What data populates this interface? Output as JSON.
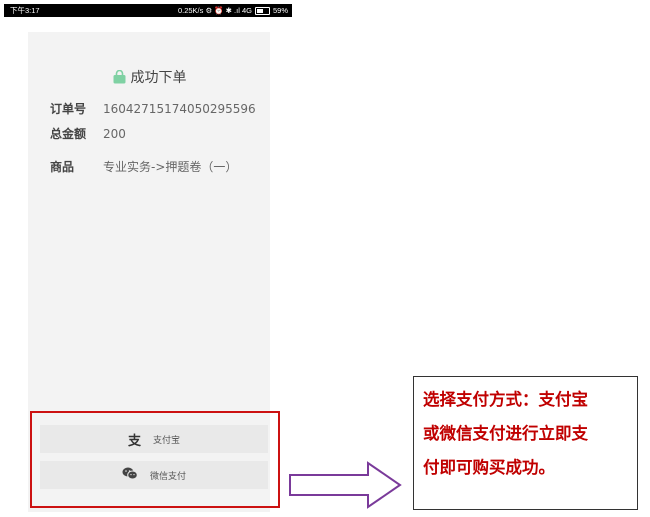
{
  "status_bar": {
    "time": "下午3:17",
    "indicators": "0.25K/s ⚙ ⏰ ✱ .ıl 4G",
    "battery": "59%",
    "battery_level": 0.59
  },
  "order": {
    "title": "成功下单",
    "fields": [
      {
        "label": "订单号",
        "value": "16042715174050295596"
      },
      {
        "label": "总金额",
        "value": "200"
      },
      {
        "label": "商品",
        "value": "专业实务->押题卷（一）"
      }
    ]
  },
  "payment": {
    "options": [
      {
        "icon": "alipay-icon",
        "glyph": "支",
        "label": "支付宝"
      },
      {
        "icon": "wechat-icon",
        "glyph": "",
        "label": "微信支付"
      }
    ]
  },
  "annotation": {
    "lines": [
      "选择支付方式：支付宝",
      "或微信支付进行立即支",
      "付即可购买成功。"
    ],
    "color": "#c00000",
    "box_color": "#cc1111",
    "arrow_color": "#7a3a9a"
  },
  "colors": {
    "accent_green": "#7fd1a3"
  }
}
